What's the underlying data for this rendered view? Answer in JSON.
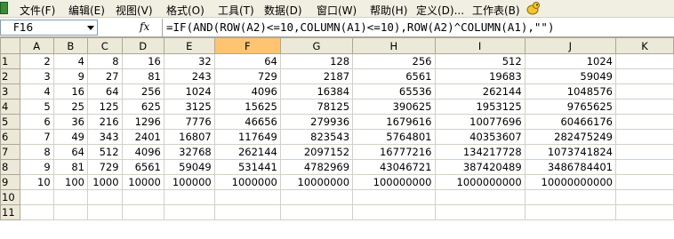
{
  "menu": {
    "items": [
      "文件(F)",
      "编辑(E)",
      "视图(V)",
      "格式(O)",
      "工具(T)",
      "数据(D)",
      "窗口(W)",
      "帮助(H)",
      "定义(D)...",
      "工作表(B)"
    ]
  },
  "formula_bar": {
    "name_box": "F16",
    "fx_label": "fx",
    "formula": "=IF(AND(ROW(A2)<=10,COLUMN(A1)<=10),ROW(A2)^COLUMN(A1),\"\")"
  },
  "sheet": {
    "selected_column": "F",
    "column_headers": [
      "A",
      "B",
      "C",
      "D",
      "E",
      "F",
      "G",
      "H",
      "I",
      "J",
      "K"
    ],
    "rows": [
      {
        "label": "1",
        "cells": [
          "2",
          "4",
          "8",
          "16",
          "32",
          "64",
          "128",
          "256",
          "512",
          "1024",
          ""
        ]
      },
      {
        "label": "2",
        "cells": [
          "3",
          "9",
          "27",
          "81",
          "243",
          "729",
          "2187",
          "6561",
          "19683",
          "59049",
          ""
        ]
      },
      {
        "label": "3",
        "cells": [
          "4",
          "16",
          "64",
          "256",
          "1024",
          "4096",
          "16384",
          "65536",
          "262144",
          "1048576",
          ""
        ]
      },
      {
        "label": "4",
        "cells": [
          "5",
          "25",
          "125",
          "625",
          "3125",
          "15625",
          "78125",
          "390625",
          "1953125",
          "9765625",
          ""
        ]
      },
      {
        "label": "5",
        "cells": [
          "6",
          "36",
          "216",
          "1296",
          "7776",
          "46656",
          "279936",
          "1679616",
          "10077696",
          "60466176",
          ""
        ]
      },
      {
        "label": "6",
        "cells": [
          "7",
          "49",
          "343",
          "2401",
          "16807",
          "117649",
          "823543",
          "5764801",
          "40353607",
          "282475249",
          ""
        ]
      },
      {
        "label": "7",
        "cells": [
          "8",
          "64",
          "512",
          "4096",
          "32768",
          "262144",
          "2097152",
          "16777216",
          "134217728",
          "1073741824",
          ""
        ]
      },
      {
        "label": "8",
        "cells": [
          "9",
          "81",
          "729",
          "6561",
          "59049",
          "531441",
          "4782969",
          "43046721",
          "387420489",
          "3486784401",
          ""
        ]
      },
      {
        "label": "9",
        "cells": [
          "10",
          "100",
          "1000",
          "10000",
          "100000",
          "1000000",
          "10000000",
          "100000000",
          "1000000000",
          "10000000000",
          ""
        ]
      },
      {
        "label": "10",
        "cells": [
          "",
          "",
          "",
          "",
          "",
          "",
          "",
          "",
          "",
          "",
          ""
        ]
      },
      {
        "label": "11",
        "cells": [
          "",
          "",
          "",
          "",
          "",
          "",
          "",
          "",
          "",
          "",
          ""
        ]
      }
    ]
  }
}
